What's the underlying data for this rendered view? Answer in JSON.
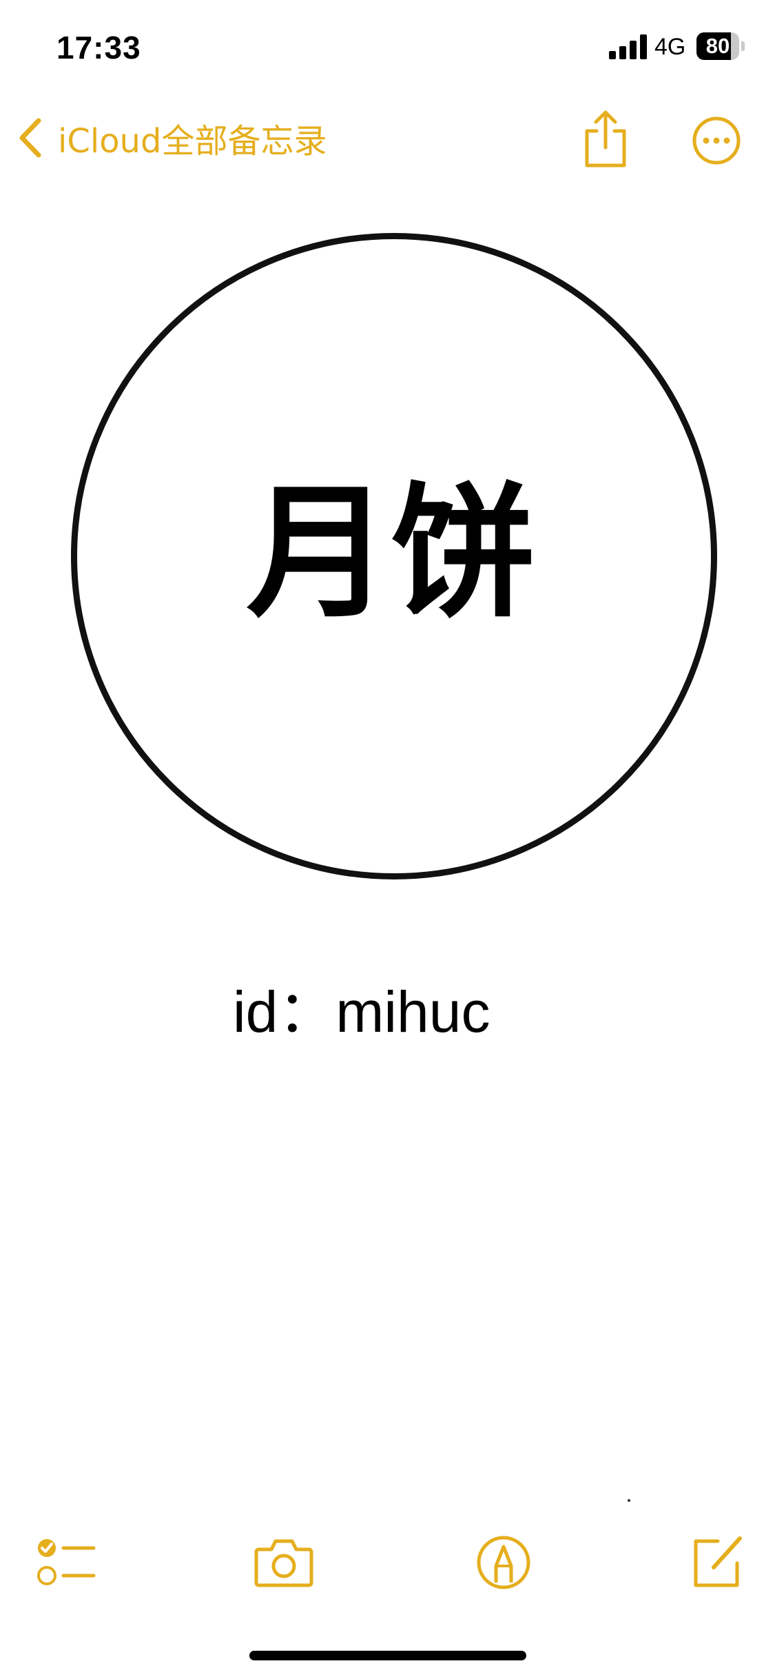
{
  "status_bar": {
    "time": "17:33",
    "network": "4G",
    "battery_level": "80",
    "battery_fraction": 0.8,
    "signal_icon": "cellular-signal-icon"
  },
  "nav": {
    "back_label": "iCloud全部备忘录",
    "back_icon": "chevron-left-icon",
    "share_icon": "share-icon",
    "more_icon": "ellipsis-circle-icon"
  },
  "note": {
    "title": "月饼",
    "id_text": "id：mihuc"
  },
  "toolbar": {
    "checklist_icon": "checklist-icon",
    "camera_icon": "camera-icon",
    "markup_icon": "markup-pen-icon",
    "compose_icon": "compose-icon"
  },
  "colors": {
    "accent": "#E5AE1D",
    "text": "#000000",
    "background": "#FFFFFF"
  }
}
